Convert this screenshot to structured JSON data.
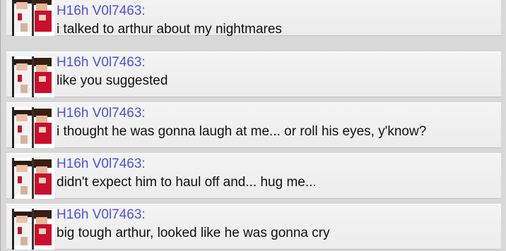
{
  "chat": {
    "messages": [
      {
        "sender": "H16h V0l7463:",
        "text": "i talked to arthur about my nightmares",
        "avatar_icon": "character-pixel-avatar-icon"
      },
      {
        "sender": "H16h V0l7463:",
        "text": "like you suggested",
        "avatar_icon": "character-pixel-avatar-icon"
      },
      {
        "sender": "H16h V0l7463:",
        "text": "i thought he was gonna laugh at me... or roll his eyes, y'know?",
        "avatar_icon": "character-pixel-avatar-icon"
      },
      {
        "sender": "H16h V0l7463:",
        "text": "didn't expect him to haul off and... hug me...",
        "avatar_icon": "character-pixel-avatar-icon"
      },
      {
        "sender": "H16h V0l7463:",
        "text": "big tough arthur, looked like he was gonna cry",
        "avatar_icon": "character-pixel-avatar-icon"
      }
    ]
  },
  "colors": {
    "sender": "#4f53d6",
    "text": "#111111",
    "row_bg": "#f0f0f0"
  }
}
